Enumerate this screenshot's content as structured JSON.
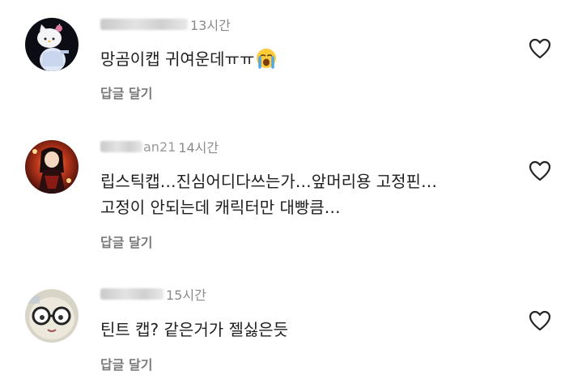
{
  "comments": [
    {
      "username_visible_suffix": "ır",
      "timestamp": "13시간",
      "lines": [
        "망곰이캡 귀여운데ㅠㅠ"
      ],
      "emoji": "loudly-crying-face",
      "reply_label": "답글 달기",
      "avatar": "hello-kitty-plush-avatar"
    },
    {
      "username_visible_suffix": "an21",
      "timestamp": "14시간",
      "lines": [
        "립스틱캡…진심어디다쓰는가…앞머리용 고정핀…",
        "고정이 안되는데 캐릭터만 대빵큼…"
      ],
      "reply_label": "답글 달기",
      "avatar": "anime-character-red-avatar"
    },
    {
      "username_visible_suffix": "j",
      "timestamp": "15시간",
      "lines": [
        "틴트 캡? 같은거가 젤싫은듯"
      ],
      "reply_label": "답글 달기",
      "avatar": "glasses-doll-avatar"
    }
  ],
  "icons": {
    "like": "heart-outline-icon"
  },
  "colors": {
    "text": "#1e1e1e",
    "secondary": "#8a8a8a",
    "reply": "#7a7a7a",
    "background": "#ffffff"
  }
}
